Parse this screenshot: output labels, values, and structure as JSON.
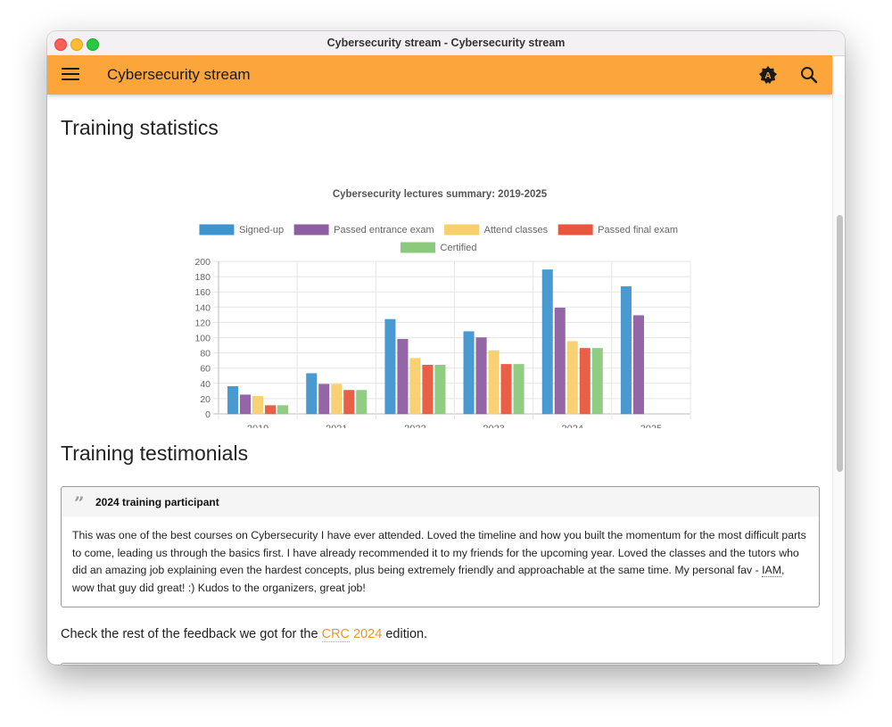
{
  "window": {
    "title": "Cybersecurity stream - Cybersecurity stream"
  },
  "appbar": {
    "title": "Cybersecurity stream",
    "menu_icon": "hamburger-menu-icon",
    "lang_icon": "translate-icon",
    "search_icon": "search-icon",
    "color": "#fba53a"
  },
  "sections": {
    "stats_heading": "Training statistics",
    "testimonials_heading": "Training testimonials"
  },
  "chart_data": {
    "type": "bar",
    "title": "Cybersecurity lectures summary: 2019-2025",
    "categories": [
      "2019",
      "2021",
      "2022",
      "2023",
      "2024",
      "2025"
    ],
    "ylim": [
      0,
      200
    ],
    "yticks": [
      0,
      20,
      40,
      60,
      80,
      100,
      120,
      140,
      160,
      180,
      200
    ],
    "grid": true,
    "legend_position": "top",
    "series": [
      {
        "name": "Signed-up",
        "color": "#3e95cd",
        "values": [
          36,
          53,
          124,
          108,
          189,
          167
        ]
      },
      {
        "name": "Passed entrance exam",
        "color": "#8e5ea2",
        "values": [
          25,
          39,
          98,
          100,
          139,
          129
        ]
      },
      {
        "name": "Attend classes",
        "color": "#f7cf6b",
        "values": [
          23,
          39,
          73,
          83,
          95,
          0
        ]
      },
      {
        "name": "Passed final exam",
        "color": "#e8573c",
        "values": [
          11,
          31,
          64,
          65,
          86,
          0
        ]
      },
      {
        "name": "Certified",
        "color": "#8bc97c",
        "values": [
          11,
          31,
          64,
          65,
          86,
          0
        ]
      }
    ]
  },
  "testimonial": {
    "title": "2024 training participant",
    "body_pre": "This was one of the best courses on Cybersecurity I have ever attended. Loved the timeline and how you built the momentum for the most difficult parts to come, leading us through the basics first. I have already recommended it to my friends for the upcoming year. Loved the classes and the tutors who did an amazing job explaining even the hardest concepts, plus being extremely friendly and approachable at the same time. My personal fav - ",
    "body_abbr": "IAM",
    "body_post": ", wow that guy did great! :) Kudos to the organizers, great job!"
  },
  "feedback": {
    "pre": "Check the rest of the feedback we got for the ",
    "link1": "CRC",
    "space": " ",
    "link2": "2024",
    "post": " edition."
  }
}
